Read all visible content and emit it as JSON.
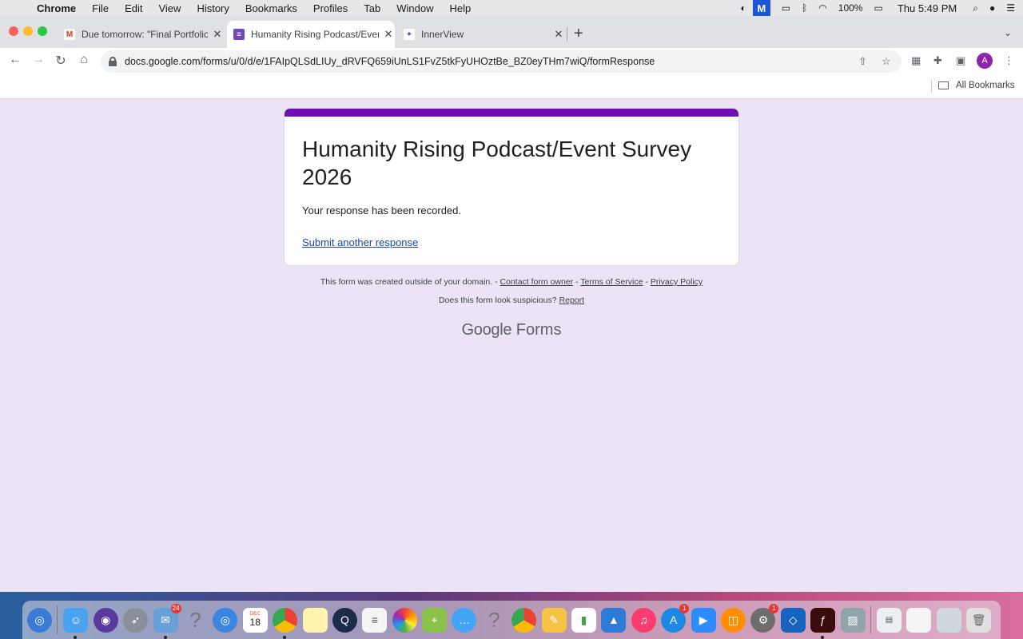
{
  "menubar": {
    "app": "Chrome",
    "items": [
      "File",
      "Edit",
      "View",
      "History",
      "Bookmarks",
      "Profiles",
      "Tab",
      "Window",
      "Help"
    ],
    "battery": "100%",
    "clock": "Thu 5:49 PM"
  },
  "tabs": [
    {
      "label": "Due tomorrow: \"Final Portfolio",
      "icon": "gmail-icon",
      "active": false
    },
    {
      "label": "Humanity Rising Podcast/Event",
      "icon": "google-forms-icon",
      "active": true
    },
    {
      "label": "InnerView",
      "icon": "innerview-icon",
      "active": false
    }
  ],
  "toolbar": {
    "url": "docs.google.com/forms/u/0/d/e/1FAIpQLSdLIUy_dRVFQ659iUnLS1FvZ5tkFyUHOztBe_BZ0eyTHm7wiQ/formResponse",
    "profile_initial": "A"
  },
  "bookmarks": {
    "all_label": "All Bookmarks"
  },
  "form": {
    "title": "Humanity Rising Podcast/Event Survey 2026",
    "message": "Your response has been recorded.",
    "submit_another": "Submit another response",
    "accent_color": "#7010b2"
  },
  "footer": {
    "domain_note": "This form was created outside of your domain.",
    "contact_owner": "Contact form owner",
    "terms": "Terms of Service",
    "privacy": "Privacy Policy",
    "suspicious": "Does this form look suspicious?",
    "report": "Report",
    "brand_google": "Google",
    "brand_forms": "Forms"
  },
  "dock": {
    "badges": {
      "mail": "24",
      "calendar_day": "18",
      "calendar_month": "DEC",
      "appstore": "1",
      "settings": "1"
    }
  }
}
